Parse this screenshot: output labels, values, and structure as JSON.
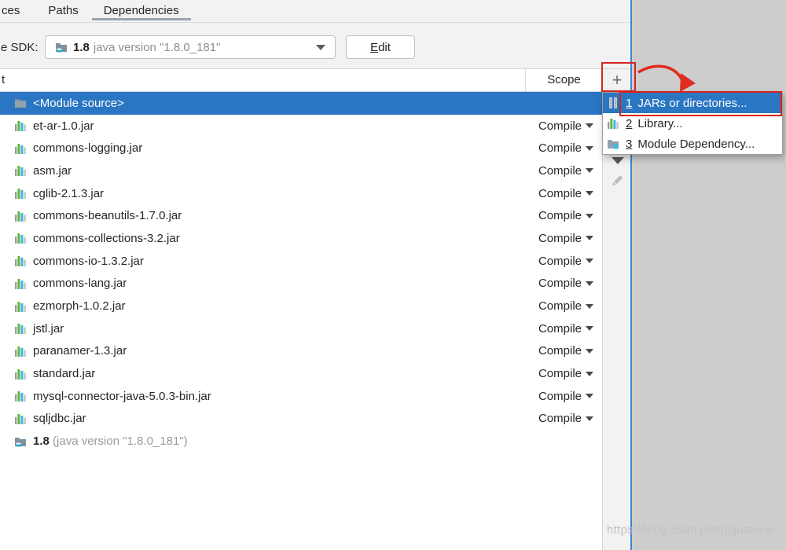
{
  "tabs": [
    {
      "label": "ces"
    },
    {
      "label": "Paths"
    },
    {
      "label": "Dependencies",
      "selected": true
    }
  ],
  "sdk": {
    "label": "e SDK:",
    "value_main": "1.8",
    "value_rest": "java version \"1.8.0_181\"",
    "edit_accel": "E",
    "edit_rest": "dit"
  },
  "table": {
    "header": {
      "export_fragment": "t",
      "scope": "Scope"
    },
    "rows": [
      {
        "icon": "folder",
        "name": "<Module source>",
        "scope": "",
        "selected": true
      },
      {
        "icon": "library",
        "name": "et-ar-1.0.jar",
        "scope": "Compile"
      },
      {
        "icon": "library",
        "name": "commons-logging.jar",
        "scope": "Compile"
      },
      {
        "icon": "library",
        "name": "asm.jar",
        "scope": "Compile"
      },
      {
        "icon": "library",
        "name": "cglib-2.1.3.jar",
        "scope": "Compile"
      },
      {
        "icon": "library",
        "name": "commons-beanutils-1.7.0.jar",
        "scope": "Compile"
      },
      {
        "icon": "library",
        "name": "commons-collections-3.2.jar",
        "scope": "Compile"
      },
      {
        "icon": "library",
        "name": "commons-io-1.3.2.jar",
        "scope": "Compile"
      },
      {
        "icon": "library",
        "name": "commons-lang.jar",
        "scope": "Compile"
      },
      {
        "icon": "library",
        "name": "ezmorph-1.0.2.jar",
        "scope": "Compile"
      },
      {
        "icon": "library",
        "name": "jstl.jar",
        "scope": "Compile"
      },
      {
        "icon": "library",
        "name": "paranamer-1.3.jar",
        "scope": "Compile"
      },
      {
        "icon": "library",
        "name": "standard.jar",
        "scope": "Compile"
      },
      {
        "icon": "library",
        "name": "mysql-connector-java-5.0.3-bin.jar",
        "scope": "Compile"
      },
      {
        "icon": "library",
        "name": "sqljdbc.jar",
        "scope": "Compile"
      },
      {
        "icon": "sdk",
        "name": "1.8",
        "suffix": " (java version \"1.8.0_181\")",
        "bold": true,
        "scope": ""
      }
    ]
  },
  "toolbar": {
    "add_label": "+"
  },
  "popup": {
    "items": [
      {
        "num": "1",
        "label": "JARs or directories...",
        "icon": "jar",
        "selected": true,
        "red_box": true
      },
      {
        "num": "2",
        "label": "Library...",
        "icon": "library"
      },
      {
        "num": "3",
        "label": "Module Dependency...",
        "icon": "module"
      }
    ]
  },
  "watermark": "https://blog.csdn.net/qcjustone",
  "colors": {
    "selection_blue": "#2a76c2",
    "annotation_red": "#d7231d",
    "dialog_edge_blue": "#3a86d8",
    "background_gray": "#cdcdcd"
  }
}
